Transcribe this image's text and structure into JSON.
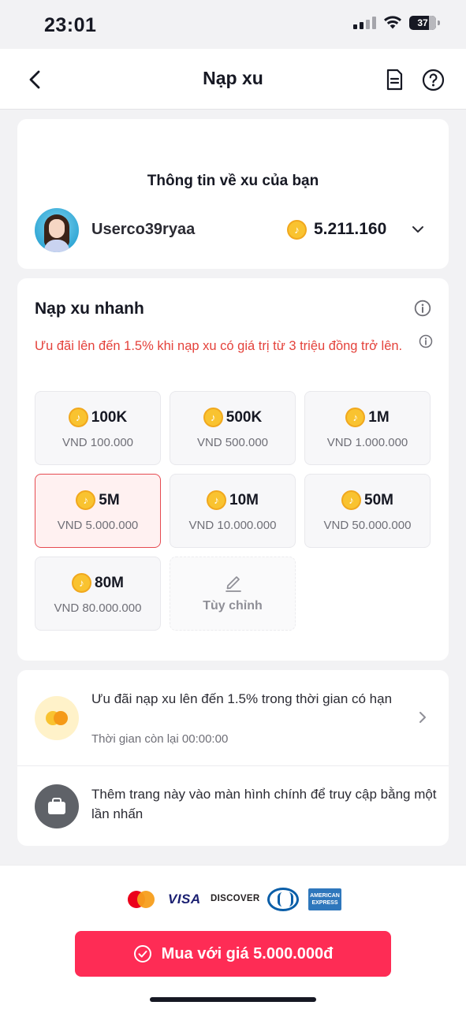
{
  "status_bar": {
    "time": "23:01",
    "battery": "37"
  },
  "nav": {
    "title": "Nạp xu",
    "back_icon": "chevron-left-icon",
    "doc_icon": "document-icon",
    "help_icon": "help-circle-icon"
  },
  "info_card": {
    "heading": "Thông tin về xu của bạn",
    "username": "Userco39ryaa",
    "balance": "5.211.160"
  },
  "quick": {
    "title": "Nạp xu nhanh",
    "promo": "Ưu đãi lên đến 1.5% khi nạp xu có giá trị từ 3 triệu đồng trở lên.",
    "options": [
      {
        "amount": "100K",
        "price": "VND 100.000"
      },
      {
        "amount": "500K",
        "price": "VND 500.000"
      },
      {
        "amount": "1M",
        "price": "VND 1.000.000"
      },
      {
        "amount": "5M",
        "price": "VND 5.000.000"
      },
      {
        "amount": "10M",
        "price": "VND 10.000.000"
      },
      {
        "amount": "50M",
        "price": "VND 50.000.000"
      },
      {
        "amount": "80M",
        "price": "VND 80.000.000"
      }
    ],
    "selected": "5M",
    "custom_label": "Tùy chỉnh"
  },
  "promo_card": {
    "line": "Ưu đãi nạp xu lên đến 1.5% trong thời gian có hạn",
    "timer": "Thời gian còn lại 00:00:00",
    "shortcut": "Thêm trang này vào màn hình chính để truy cập bằng một lần nhấn"
  },
  "payment": {
    "logos": {
      "visa": "VISA",
      "discover": "DISCOVER",
      "amex": "AMERICAN EXPRESS"
    },
    "buy_label": "Mua với giá 5.000.000đ"
  },
  "colors": {
    "accent": "#fe2c55",
    "promo_red": "#e4423b",
    "coin": "#f9c330"
  }
}
